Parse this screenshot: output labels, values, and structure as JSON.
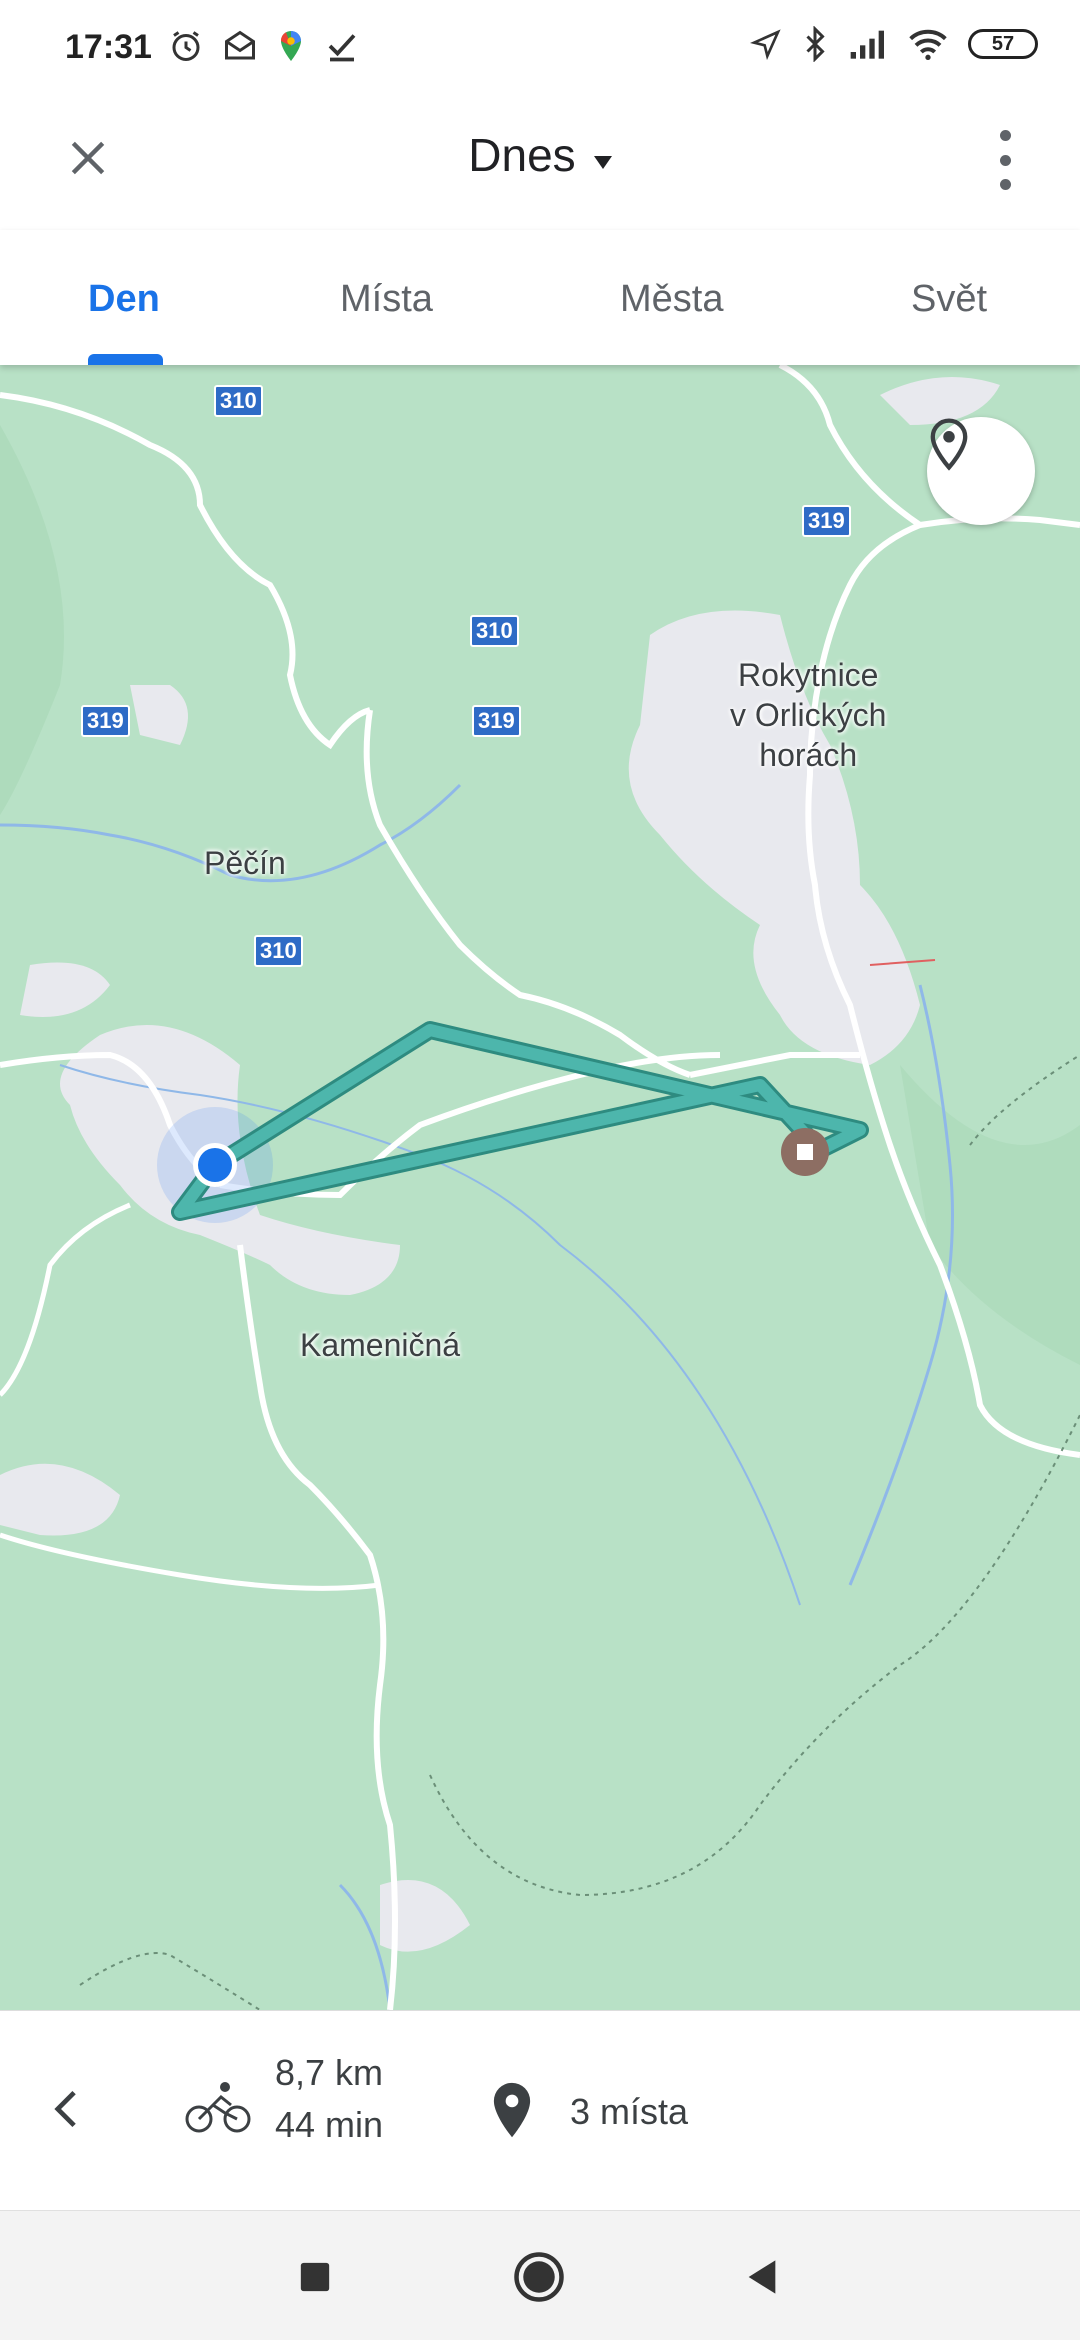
{
  "status": {
    "time": "17:31",
    "battery": "57",
    "icons_left": [
      "alarm-icon",
      "mail-icon",
      "maps-icon",
      "check-icon"
    ],
    "icons_right": [
      "location-icon",
      "bluetooth-icon",
      "signal-icon",
      "wifi-icon"
    ]
  },
  "header": {
    "title": "Dnes",
    "close_icon": "close-icon",
    "menu_icon": "more-vert-icon"
  },
  "tabs": [
    {
      "label": "Den",
      "active": true
    },
    {
      "label": "Místa",
      "active": false
    },
    {
      "label": "Města",
      "active": false
    },
    {
      "label": "Svět",
      "active": false
    }
  ],
  "map": {
    "labels": {
      "rokytnice": "Rokytnice\nv Orlických\nhorách",
      "pecin": "Pěčín",
      "kamenicna": "Kameničná"
    },
    "shields": [
      "310",
      "319",
      "310",
      "319",
      "319",
      "310"
    ],
    "route_color": "#4db6ac",
    "location_dot_color": "#1a73e8",
    "place_marker_color": "#8d6e63"
  },
  "summary": {
    "distance": "8,7 km",
    "duration": "44 min",
    "places": "3 místa"
  },
  "nav": [
    "recents-button",
    "home-button",
    "back-button"
  ]
}
